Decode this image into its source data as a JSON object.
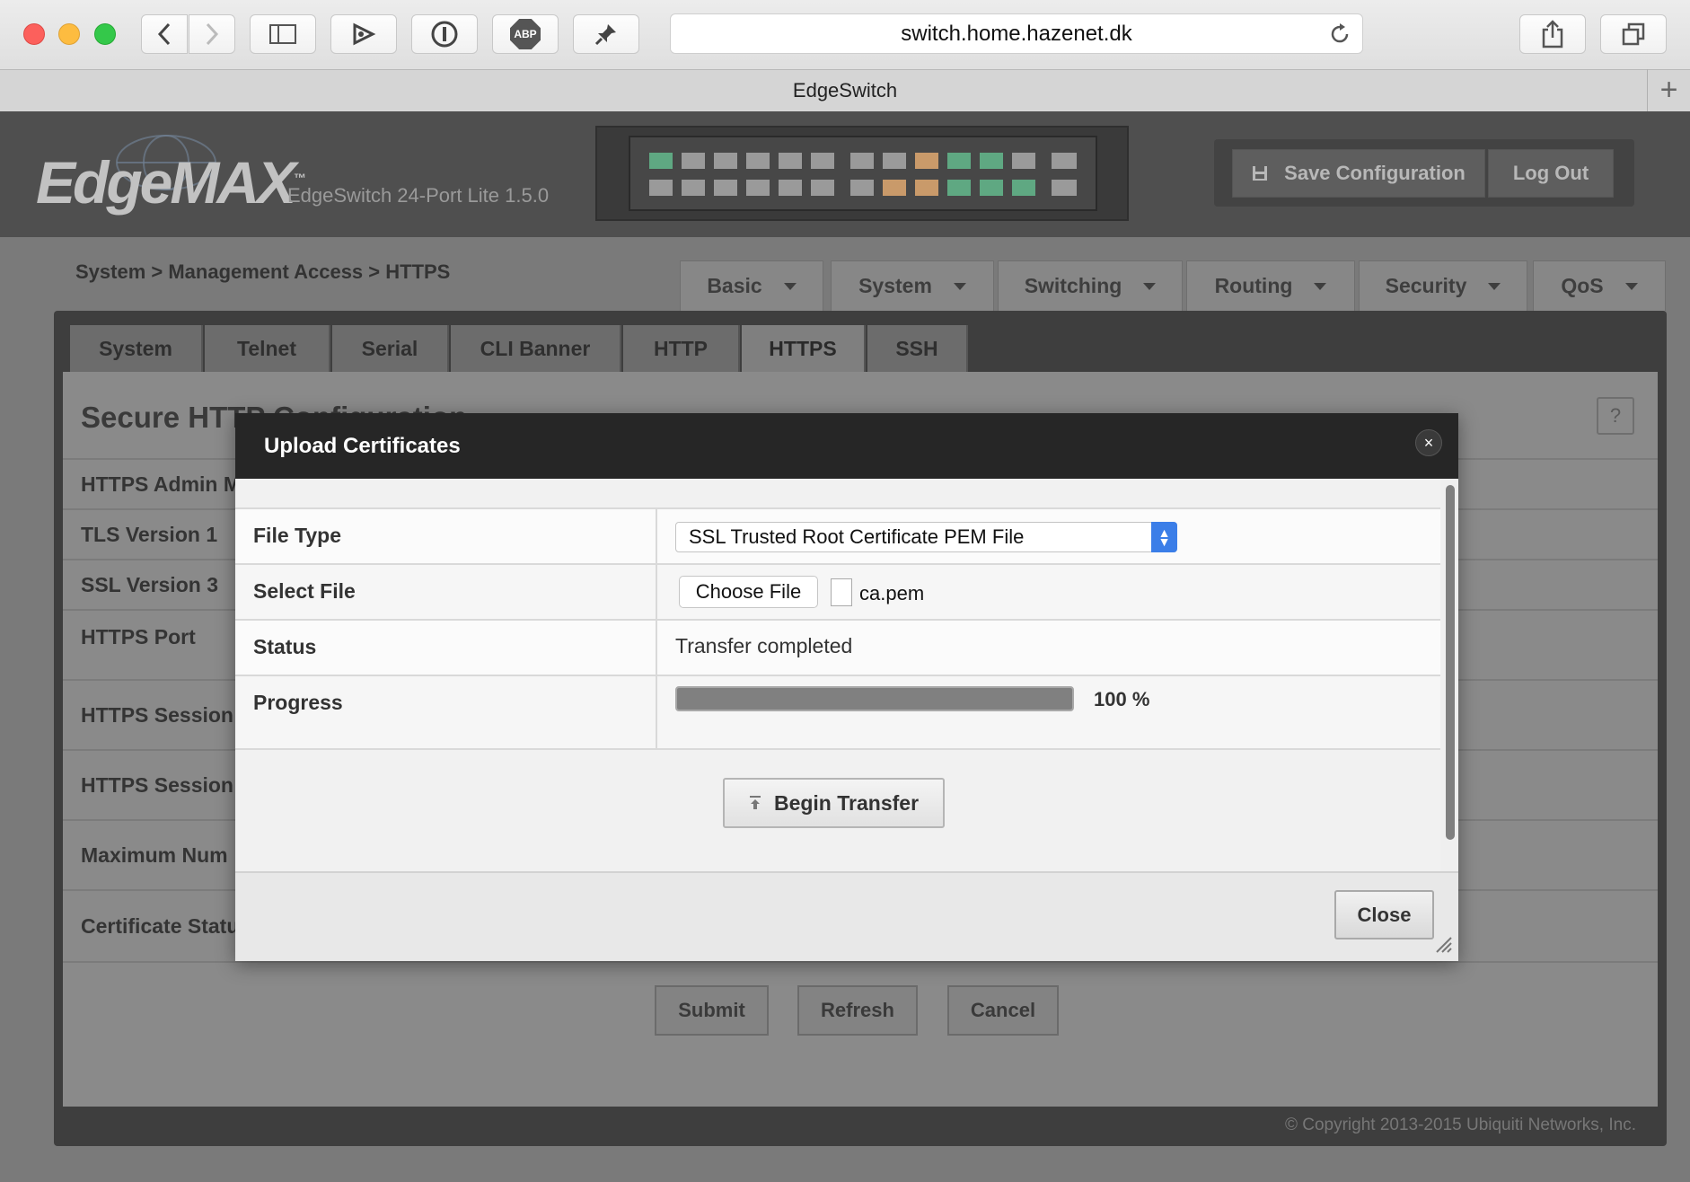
{
  "browser": {
    "url": "switch.home.hazenet.dk",
    "tab_title": "EdgeSwitch",
    "toolbar_icons": [
      "back-icon",
      "forward-icon",
      "sidebar-icon",
      "reader-icon",
      "password-icon",
      "adblock-icon",
      "pin-icon",
      "reload-icon",
      "share-icon",
      "tabs-icon",
      "new-tab-icon"
    ],
    "adblock_label": "ABP"
  },
  "header": {
    "logo": "EdgeMAX",
    "logo_tm": "™",
    "model": "EdgeSwitch 24-Port Lite 1.5.0",
    "save_label": "Save Configuration",
    "logout_label": "Log Out",
    "port_colors": {
      "active": "#5fa882",
      "warn": "#c99a6a",
      "idle": "#9a9a9a"
    },
    "ports_top": [
      "active",
      "idle",
      "idle",
      "idle",
      "idle",
      "idle",
      "idle",
      "idle",
      "warn",
      "active",
      "active",
      "idle",
      "idle"
    ],
    "ports_bottom": [
      "idle",
      "idle",
      "idle",
      "idle",
      "idle",
      "idle",
      "idle",
      "warn",
      "warn",
      "active",
      "active",
      "active",
      "idle"
    ]
  },
  "breadcrumb": "System > Management Access > HTTPS",
  "nav": [
    "Basic",
    "System",
    "Switching",
    "Routing",
    "Security",
    "QoS"
  ],
  "subtabs": [
    "System",
    "Telnet",
    "Serial",
    "CLI Banner",
    "HTTP",
    "HTTPS",
    "SSH"
  ],
  "active_subtab": "HTTPS",
  "section": {
    "title": "Secure HTTP Configuration",
    "help": "?",
    "rows": [
      "HTTPS Admin M",
      "TLS Version 1",
      "SSL Version 3",
      "HTTPS Port",
      "HTTPS Session",
      "HTTPS Session",
      "Maximum Num",
      "Certificate Statu"
    ]
  },
  "form_buttons": {
    "submit": "Submit",
    "refresh": "Refresh",
    "cancel": "Cancel"
  },
  "copyright": "© Copyright 2013-2015 Ubiquiti Networks, Inc.",
  "modal": {
    "title": "Upload Certificates",
    "close_x": "×",
    "rows": {
      "file_type_label": "File Type",
      "file_type_value": "SSL Trusted Root Certificate PEM File",
      "select_file_label": "Select File",
      "choose_file_label": "Choose File",
      "file_name": "ca.pem",
      "status_label": "Status",
      "status_value": "Transfer completed",
      "progress_label": "Progress",
      "progress_value": 100,
      "progress_text": "100 %"
    },
    "begin_label": "Begin Transfer",
    "close_label": "Close"
  }
}
